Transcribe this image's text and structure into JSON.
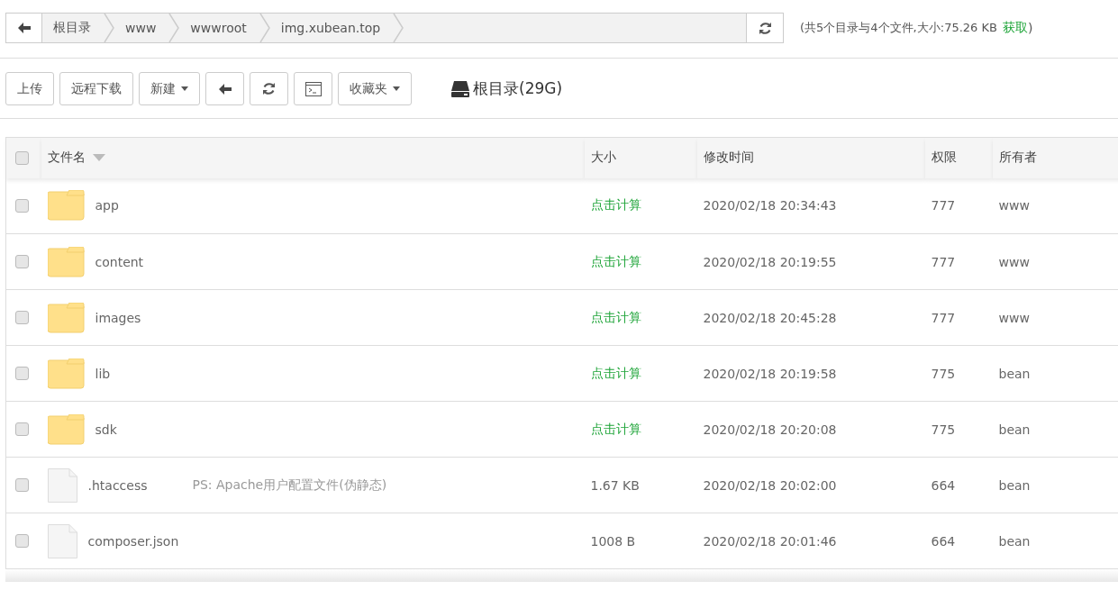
{
  "breadcrumb": {
    "items": [
      "根目录",
      "www",
      "wwwroot",
      "img.xubean.top"
    ]
  },
  "summary": {
    "text": "(共5个目录与4个文件,大小:75.26 KB",
    "link": "获取",
    "close": ")"
  },
  "toolbar": {
    "buttons": [
      {
        "kind": "text",
        "label": "上传"
      },
      {
        "kind": "text",
        "label": "远程下载"
      },
      {
        "kind": "dropdown",
        "label": "新建"
      },
      {
        "kind": "back"
      },
      {
        "kind": "refresh"
      },
      {
        "kind": "terminal"
      },
      {
        "kind": "dropdown",
        "label": "收藏夹"
      }
    ],
    "disk": "根目录(29G)"
  },
  "table": {
    "select_all": {
      "checked": false
    },
    "columns": [
      "文件名",
      "大小",
      "修改时间",
      "权限",
      "所有者"
    ],
    "rows": [
      {
        "kind": "folder",
        "name": "app",
        "size": "点击计算",
        "modified": "2020/02/18 20:34:43",
        "permission": "777",
        "owner": "www",
        "checked": false
      },
      {
        "kind": "folder",
        "name": "content",
        "size": "点击计算",
        "modified": "2020/02/18 20:19:55",
        "permission": "777",
        "owner": "www",
        "checked": false
      },
      {
        "kind": "folder",
        "name": "images",
        "size": "点击计算",
        "modified": "2020/02/18 20:45:28",
        "permission": "777",
        "owner": "www",
        "checked": false
      },
      {
        "kind": "folder",
        "name": "lib",
        "size": "点击计算",
        "modified": "2020/02/18 20:19:58",
        "permission": "775",
        "owner": "bean",
        "checked": false
      },
      {
        "kind": "folder",
        "name": "sdk",
        "size": "点击计算",
        "modified": "2020/02/18 20:20:08",
        "permission": "775",
        "owner": "bean",
        "checked": false
      },
      {
        "kind": "file",
        "name": ".htaccess",
        "note": "PS: Apache用户配置文件(伪静态)",
        "size": "1.67 KB",
        "modified": "2020/02/18 20:02:00",
        "permission": "664",
        "owner": "bean",
        "checked": false
      },
      {
        "kind": "file",
        "name": "composer.json",
        "size": "1008 B",
        "modified": "2020/02/18 20:01:46",
        "permission": "664",
        "owner": "bean",
        "checked": false
      }
    ]
  }
}
